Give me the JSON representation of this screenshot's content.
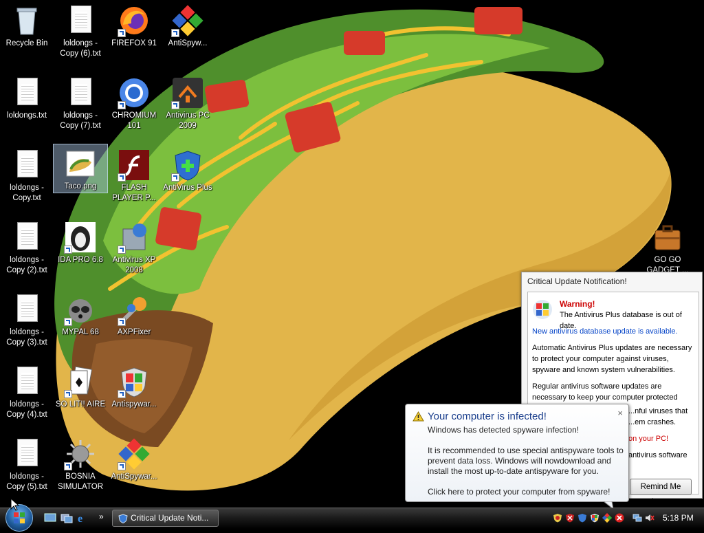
{
  "desktop": {
    "icons": [
      {
        "label": "Recycle Bin"
      },
      {
        "label": "loldongs - Copy (6).txt"
      },
      {
        "label": "FIREFOX 91"
      },
      {
        "label": "AntiSpyw..."
      },
      {
        "label": "loldongs.txt"
      },
      {
        "label": "loldongs - Copy (7).txt"
      },
      {
        "label": "CHROMIUM 101"
      },
      {
        "label": "Antivirus PC 2009"
      },
      {
        "label": "loldongs - Copy.txt"
      },
      {
        "label": "Taco.png"
      },
      {
        "label": "FLASH PLAYER P..."
      },
      {
        "label": "AntiVirus Plus"
      },
      {
        "label": "loldongs - Copy (2).txt"
      },
      {
        "label": "IDA PRO 6.8"
      },
      {
        "label": "Antivirus XP 2008"
      },
      {
        "label": "loldongs - Copy (3).txt"
      },
      {
        "label": "MYPAL 68"
      },
      {
        "label": "AXPFixer"
      },
      {
        "label": "loldongs - Copy (4).txt"
      },
      {
        "label": "SO LIT!! AIRE"
      },
      {
        "label": "Antispywar..."
      },
      {
        "label": "loldongs - Copy (5).txt"
      },
      {
        "label": "BOSNIA SIMULATOR"
      },
      {
        "label": "AntiSpywar..."
      },
      {
        "label": "GO GO GADGET ..."
      }
    ]
  },
  "critical_notification": {
    "title": "Critical Update Notification!",
    "warning_heading": "Warning!",
    "warning_text": "The Antivirus Plus database is out of date.",
    "link": "New antivirus database update is available.",
    "para1": "Automatic Antivirus Plus updates are necessary to protect your computer against viruses, spyware and known system vulnerabilities.",
    "para2_visible": "Regular antivirus software updates are necessary to keep your computer protected against the",
    "para2_line3": "...nful viruses that",
    "para2_line4": "...em crashes.",
    "red_text": "on your PC!",
    "antivirus_line": "antivirus software",
    "remind_button": "Remind Me Later"
  },
  "infected_balloon": {
    "title": "Your computer is infected!",
    "line1": "Windows has detected spyware infection!",
    "line2": "It is recommended to use special antispyware tools to prevent data loss. Windows will nowdownload and install the most up-to-date antispyware for you.",
    "line3": "Click here to protect your computer from spyware!",
    "close": "×"
  },
  "taskbar": {
    "task_button": "Critical Update Noti...",
    "overflow": "»",
    "clock": "5:18 PM"
  }
}
